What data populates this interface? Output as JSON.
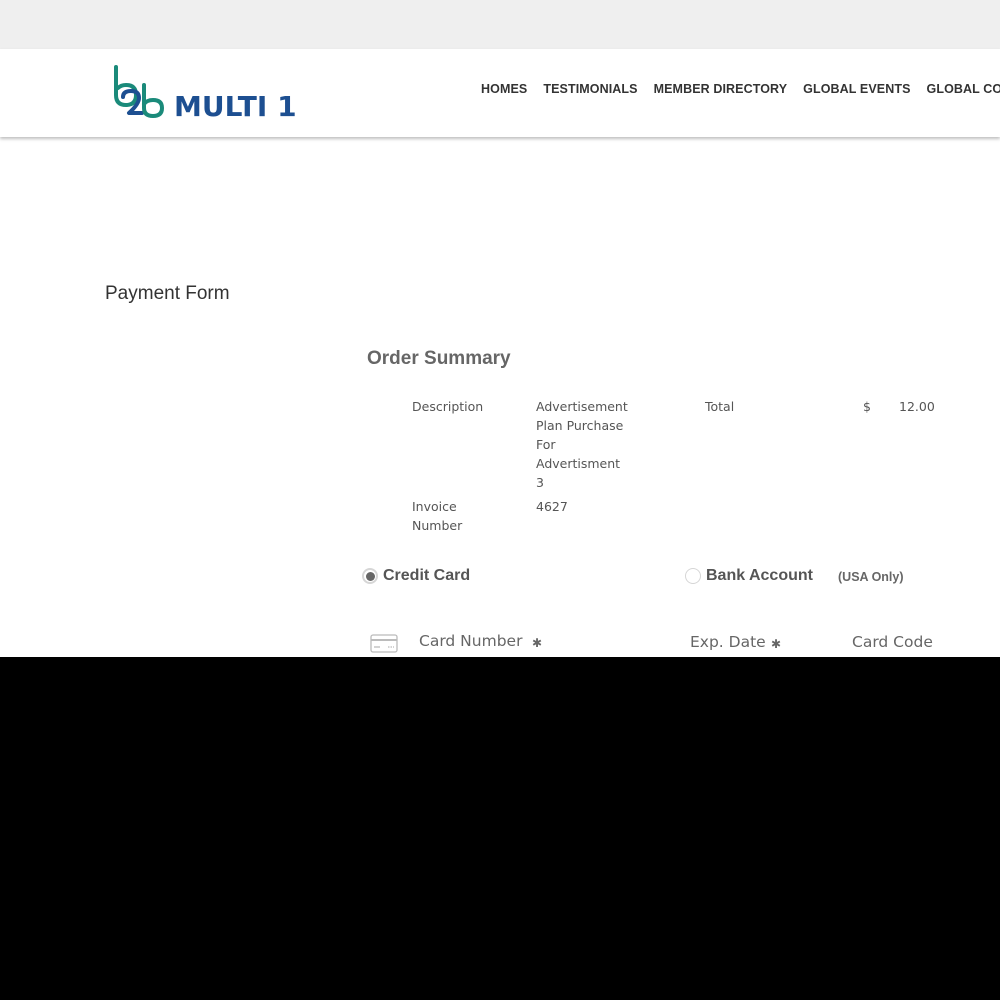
{
  "header": {
    "logo_mark": "b2b",
    "logo_text": "MULTI 1",
    "nav": [
      "HOMES",
      "TESTIMONIALS",
      "MEMBER DIRECTORY",
      "GLOBAL EVENTS",
      "GLOBAL COMM"
    ]
  },
  "page": {
    "title": "Payment Form"
  },
  "order_summary": {
    "title": "Order Summary",
    "description_label": "Description",
    "description_lines": [
      "Advertisement",
      "Plan Purchase",
      "For",
      "Advertisment",
      "3"
    ],
    "total_label": "Total",
    "currency": "$",
    "total_value": "12.00",
    "invoice_label_lines": [
      "Invoice",
      "Number"
    ],
    "invoice_value": "4627"
  },
  "payment_method": {
    "credit_card_label": "Credit Card",
    "credit_card_selected": true,
    "bank_account_label": "Bank Account",
    "bank_account_note": "(USA Only)"
  },
  "fields": {
    "card_number_label": "Card Number",
    "exp_date_label": "Exp. Date",
    "card_code_label": "Card Code",
    "required_marker": "✱"
  },
  "colors": {
    "logo_teal": "#1a8a7a",
    "logo_blue": "#1d4f91",
    "text_dark": "#333333",
    "text_muted": "#666666",
    "topbar_bg": "#efefef"
  }
}
